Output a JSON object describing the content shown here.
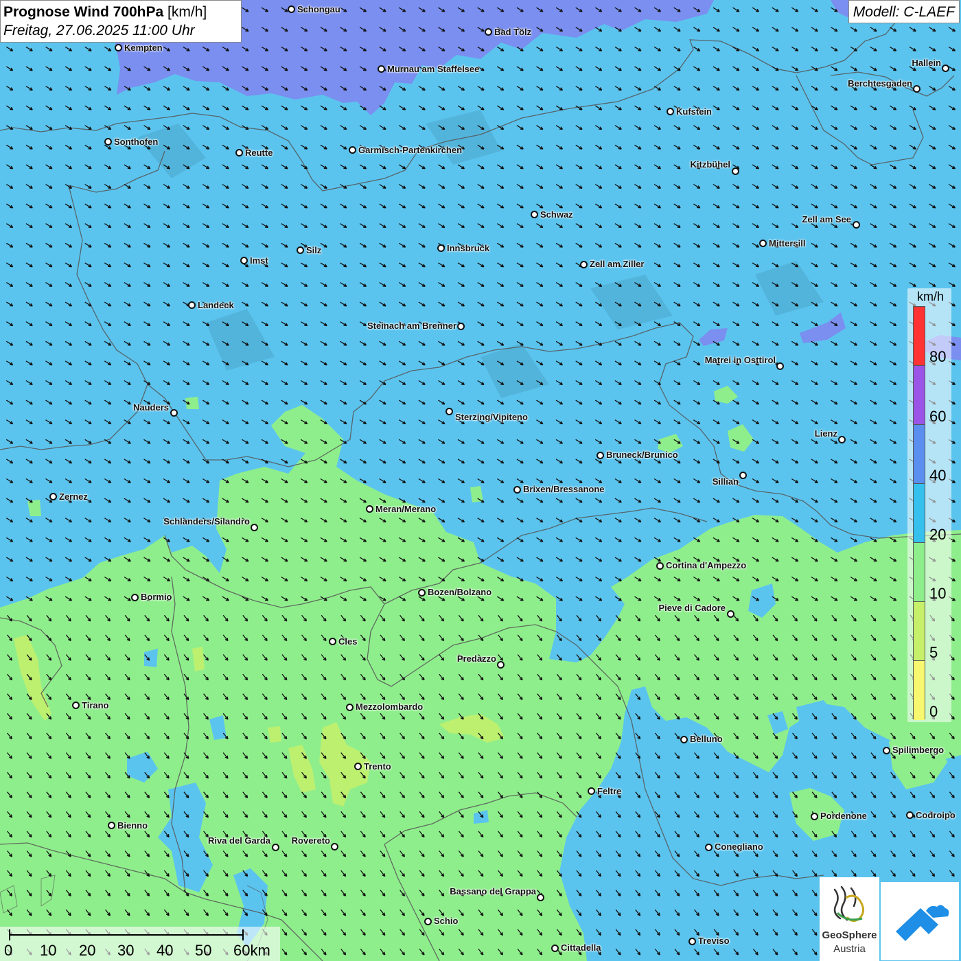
{
  "title": {
    "main": "Prognose Wind 700hPa",
    "unit": "[km/h]",
    "datetime": "Freitag, 27.06.2025 11:00 Uhr"
  },
  "model": "Modell: C-LAEF",
  "legend": {
    "unit": "km/h",
    "ticks": [
      "80",
      "60",
      "40",
      "20",
      "10",
      "5",
      "0"
    ],
    "colors": [
      "#ff3333",
      "#9a55e6",
      "#5a8ff0",
      "#35c0ee",
      "#8fee8c",
      "#c6f06a",
      "#f8f870"
    ]
  },
  "scalebar": {
    "labels": [
      "0",
      "10",
      "20",
      "30",
      "40",
      "50",
      "60km"
    ]
  },
  "logos": {
    "geosphere_name": "GeoSphere",
    "geosphere_sub": "Austria"
  },
  "colors": {
    "wind_10_20": "#8fee8c",
    "wind_20_40": "#35c0ee",
    "wind_40_60": "#7a8ff0",
    "wind_5_10": "#c6f06a",
    "arrow": "#111111",
    "border": "#555555"
  },
  "cities": [
    {
      "name": "Schongau",
      "dot": [
        424,
        13
      ],
      "label": [
        433,
        6
      ],
      "align": "left"
    },
    {
      "name": "Bad Tölz",
      "dot": [
        711,
        46
      ],
      "label": [
        720,
        39
      ],
      "align": "left"
    },
    {
      "name": "Kempten",
      "dot": [
        172,
        69
      ],
      "label": [
        181,
        62
      ],
      "align": "left"
    },
    {
      "name": "Murnau am Staffelsee",
      "dot": [
        555,
        100
      ],
      "label": [
        564,
        93
      ],
      "align": "left"
    },
    {
      "name": "Hallein",
      "dot": [
        1377,
        99
      ],
      "label": [
        1371,
        84
      ],
      "align": "right"
    },
    {
      "name": "Berchtesgaden",
      "dot": [
        1335,
        129
      ],
      "label": [
        1329,
        114
      ],
      "align": "right"
    },
    {
      "name": "Kufstein",
      "dot": [
        976,
        162
      ],
      "label": [
        985,
        155
      ],
      "align": "left"
    },
    {
      "name": "Sonthofen",
      "dot": [
        157,
        206
      ],
      "label": [
        166,
        199
      ],
      "align": "left"
    },
    {
      "name": "Reutte",
      "dot": [
        348,
        222
      ],
      "label": [
        357,
        215
      ],
      "align": "left"
    },
    {
      "name": "Garmisch-Partenkirchen",
      "dot": [
        513,
        218
      ],
      "label": [
        522,
        211
      ],
      "align": "left"
    },
    {
      "name": "Kitzbühel",
      "dot": [
        1071,
        249
      ],
      "label": [
        1064,
        232
      ],
      "align": "right"
    },
    {
      "name": "Schwaz",
      "dot": [
        778,
        312
      ],
      "label": [
        787,
        305
      ],
      "align": "left"
    },
    {
      "name": "Zell am See",
      "dot": [
        1247,
        327
      ],
      "label": [
        1240,
        312
      ],
      "align": "right"
    },
    {
      "name": "Mittersill",
      "dot": [
        1111,
        354
      ],
      "label": [
        1120,
        347
      ],
      "align": "left"
    },
    {
      "name": "Innsbruck",
      "dot": [
        642,
        361
      ],
      "label": [
        651,
        354
      ],
      "align": "left"
    },
    {
      "name": "Silz",
      "dot": [
        437,
        364
      ],
      "label": [
        446,
        357
      ],
      "align": "left"
    },
    {
      "name": "Imst",
      "dot": [
        355,
        379
      ],
      "label": [
        364,
        372
      ],
      "align": "left"
    },
    {
      "name": "Zell am Ziller",
      "dot": [
        850,
        385
      ],
      "label": [
        859,
        377
      ],
      "align": "left"
    },
    {
      "name": "Landeck",
      "dot": [
        279,
        444
      ],
      "label": [
        288,
        437
      ],
      "align": "left"
    },
    {
      "name": "Steinach am Brenner",
      "dot": [
        671,
        475
      ],
      "label": [
        665,
        467
      ],
      "align": "right"
    },
    {
      "name": "Matrei in Osttirol",
      "dot": [
        1136,
        533
      ],
      "label": [
        1130,
        517
      ],
      "align": "right"
    },
    {
      "name": "Nauders",
      "dot": [
        253,
        601
      ],
      "label": [
        246,
        586
      ],
      "align": "right"
    },
    {
      "name": "Sterzing/Vipiteno",
      "dot": [
        654,
        599
      ],
      "label": [
        663,
        600
      ],
      "align": "left"
    },
    {
      "name": "Lienz",
      "dot": [
        1226,
        640
      ],
      "label": [
        1220,
        624
      ],
      "align": "right"
    },
    {
      "name": "Bruneck/Brunico",
      "dot": [
        874,
        663
      ],
      "label": [
        883,
        655
      ],
      "align": "left"
    },
    {
      "name": "Sillian",
      "dot": [
        1082,
        692
      ],
      "label": [
        1076,
        694
      ],
      "align": "right"
    },
    {
      "name": "Brixen/Bressanone",
      "dot": [
        753,
        713
      ],
      "label": [
        762,
        705
      ],
      "align": "left"
    },
    {
      "name": "Zernez",
      "dot": [
        77,
        723
      ],
      "label": [
        86,
        716
      ],
      "align": "left"
    },
    {
      "name": "Meran/Merano",
      "dot": [
        538,
        741
      ],
      "label": [
        547,
        734
      ],
      "align": "left"
    },
    {
      "name": "Schlanders/Silandro",
      "dot": [
        370,
        768
      ],
      "label": [
        364,
        752
      ],
      "align": "right"
    },
    {
      "name": "Cortina d'Ampezzo",
      "dot": [
        961,
        824
      ],
      "label": [
        970,
        816
      ],
      "align": "left"
    },
    {
      "name": "Bozen/Bolzano",
      "dot": [
        614,
        863
      ],
      "label": [
        623,
        855
      ],
      "align": "left"
    },
    {
      "name": "Bormio",
      "dot": [
        196,
        870
      ],
      "label": [
        205,
        862
      ],
      "align": "left"
    },
    {
      "name": "Pieve di Cadore",
      "dot": [
        1064,
        894
      ],
      "label": [
        1057,
        878
      ],
      "align": "right"
    },
    {
      "name": "Cles",
      "dot": [
        484,
        934
      ],
      "label": [
        493,
        927
      ],
      "align": "left"
    },
    {
      "name": "Predazzo",
      "dot": [
        729,
        968
      ],
      "label": [
        723,
        952
      ],
      "align": "right"
    },
    {
      "name": "Tirano",
      "dot": [
        110,
        1027
      ],
      "label": [
        119,
        1020
      ],
      "align": "left"
    },
    {
      "name": "Mezzolombardo",
      "dot": [
        509,
        1030
      ],
      "label": [
        518,
        1022
      ],
      "align": "left"
    },
    {
      "name": "Belluno",
      "dot": [
        996,
        1077
      ],
      "label": [
        1005,
        1069
      ],
      "align": "left"
    },
    {
      "name": "Spilimbergo",
      "dot": [
        1291,
        1093
      ],
      "label": [
        1300,
        1085
      ],
      "align": "left"
    },
    {
      "name": "Trento",
      "dot": [
        521,
        1116
      ],
      "label": [
        530,
        1109
      ],
      "align": "left"
    },
    {
      "name": "Feltre",
      "dot": [
        861,
        1152
      ],
      "label": [
        870,
        1145
      ],
      "align": "left"
    },
    {
      "name": "Pordenone",
      "dot": [
        1186,
        1189
      ],
      "label": [
        1195,
        1181
      ],
      "align": "left"
    },
    {
      "name": "Codroipo",
      "dot": [
        1325,
        1187
      ],
      "label": [
        1334,
        1180
      ],
      "align": "left"
    },
    {
      "name": "Bienno",
      "dot": [
        162,
        1202
      ],
      "label": [
        171,
        1195
      ],
      "align": "left"
    },
    {
      "name": "Riva del Garda",
      "dot": [
        401,
        1234
      ],
      "label": [
        394,
        1217
      ],
      "align": "right"
    },
    {
      "name": "Rovereto",
      "dot": [
        487,
        1233
      ],
      "label": [
        481,
        1217
      ],
      "align": "right"
    },
    {
      "name": "Conegliano",
      "dot": [
        1032,
        1234
      ],
      "label": [
        1041,
        1226
      ],
      "align": "left"
    },
    {
      "name": "Bassano del Grappa",
      "dot": [
        787,
        1307
      ],
      "label": [
        781,
        1291
      ],
      "align": "right"
    },
    {
      "name": "Schio",
      "dot": [
        623,
        1342
      ],
      "label": [
        632,
        1334
      ],
      "align": "left"
    },
    {
      "name": "Treviso",
      "dot": [
        1008,
        1371
      ],
      "label": [
        1017,
        1363
      ],
      "align": "left"
    },
    {
      "name": "Cittadella",
      "dot": [
        808,
        1381
      ],
      "label": [
        817,
        1373
      ],
      "align": "left"
    }
  ]
}
